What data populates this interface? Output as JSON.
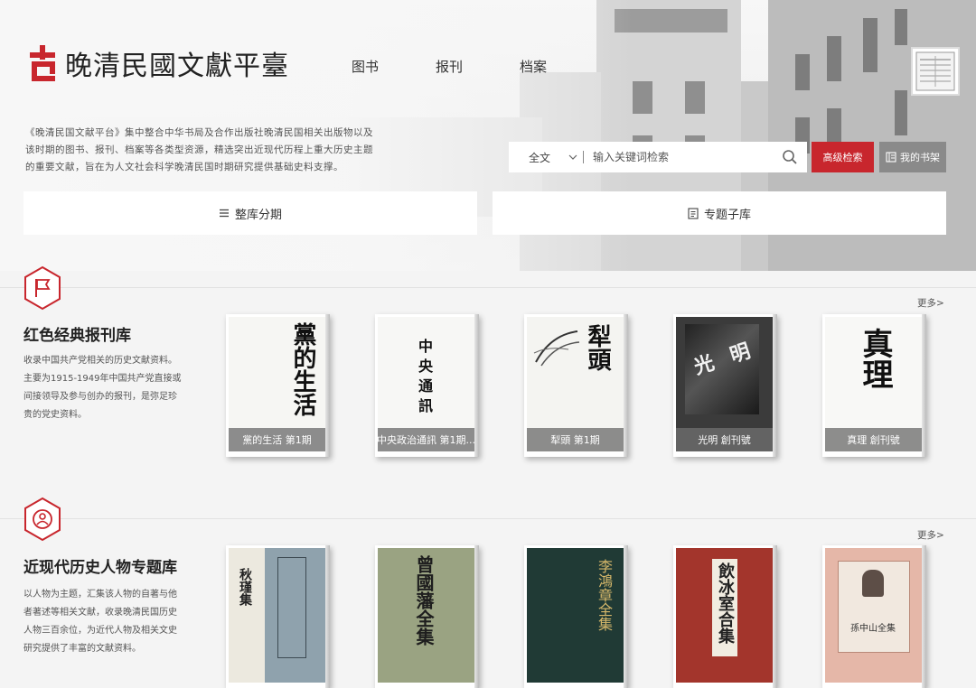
{
  "site": {
    "logo_text": "晚清民國文獻平臺",
    "intro": "《晚清民国文献平台》集中整合中华书局及合作出版社晚清民国相关出版物以及该时期的图书、报刊、档案等各类型资源，精选突出近现代历程上重大历史主题的重要文献，旨在为人文社会科学晚清民国时期研究提供基础史料支撑。"
  },
  "nav": {
    "items": [
      {
        "label": "图书"
      },
      {
        "label": "报刊"
      },
      {
        "label": "档案"
      }
    ]
  },
  "search": {
    "scope": "全文",
    "placeholder": "输入关键词检索",
    "advanced_label": "高级检索",
    "shelf_label": "我的书架"
  },
  "tabs": [
    {
      "label": "整库分期"
    },
    {
      "label": "专题子库"
    }
  ],
  "sections": [
    {
      "title": "红色经典报刊库",
      "description": "收录中国共产党相关的历史文献资料。主要为1915-1949年中国共产党直接或间接领导及参与创办的报刊，是弥足珍贵的党史资料。",
      "more": "更多>",
      "items": [
        {
          "label": "黨的生活 第1期",
          "cover_text": "黨的生活"
        },
        {
          "label": "中央政治通訊 第1期...",
          "cover_text": "中央通訊"
        },
        {
          "label": "犁頭 第1期",
          "cover_text": "犁頭"
        },
        {
          "label": "光明 創刊號",
          "cover_text": "光明"
        },
        {
          "label": "真理 創刊號",
          "cover_text": "真理"
        }
      ]
    },
    {
      "title": "近现代历史人物专题库",
      "description": "以人物为主题，汇集该人物的自著与他者著述等相关文献，收录晚清民国历史人物三百余位，为近代人物及相关文史研究提供了丰富的文献资料。",
      "more": "更多>",
      "items": [
        {
          "cover_text": "秋瑾集"
        },
        {
          "cover_text": "曾國藩全集"
        },
        {
          "cover_text": "李鴻章全集"
        },
        {
          "cover_text": "飲冰室合集"
        },
        {
          "cover_text": "孫中山全集"
        }
      ]
    }
  ],
  "colors": {
    "accent": "#c8262d",
    "gray_button": "#8a8a8a"
  }
}
